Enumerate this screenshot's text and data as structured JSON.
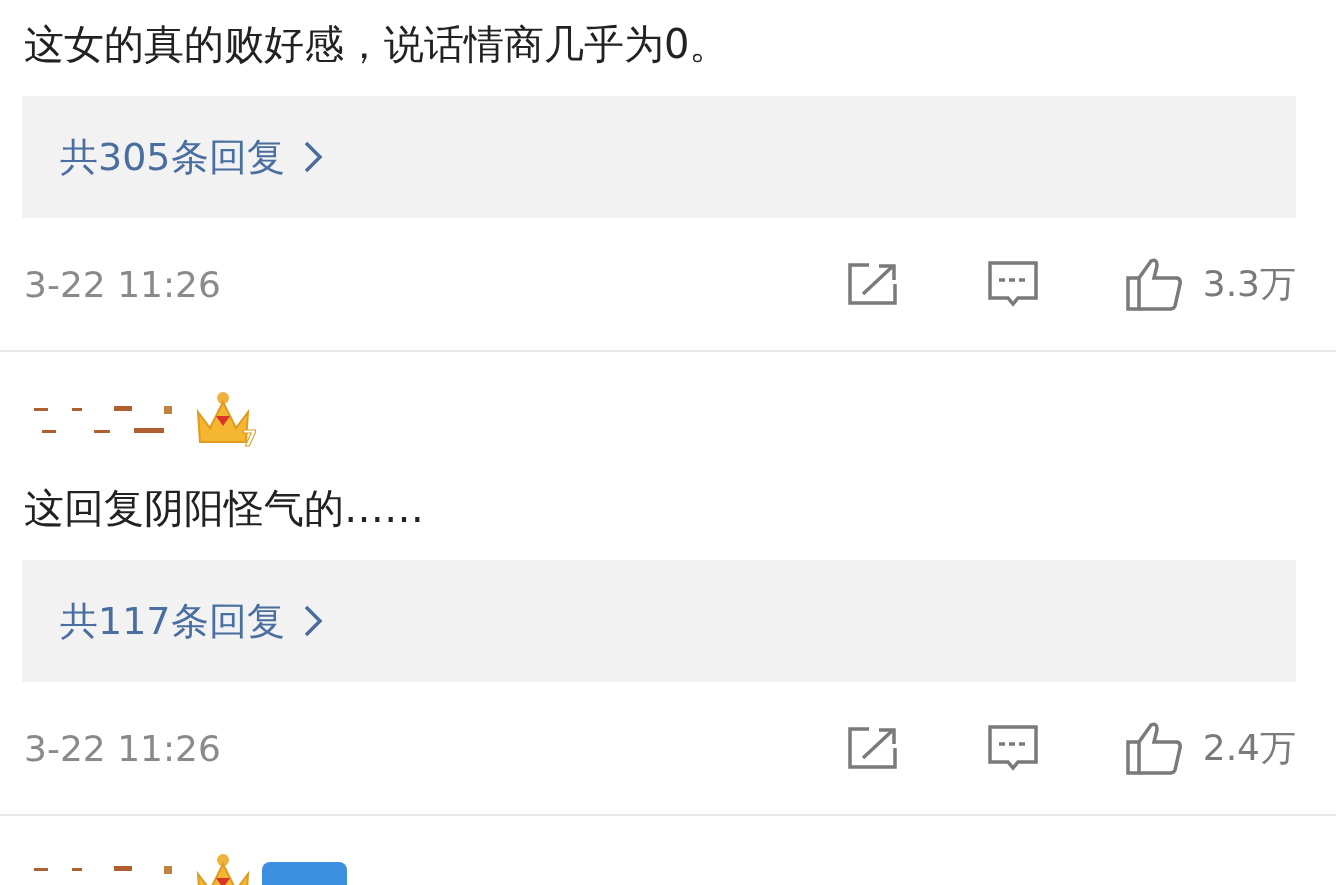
{
  "comments": [
    {
      "kind": "continued",
      "text": "这女的真的败好感，说话情商几乎为0。",
      "replies": "共305条回复",
      "time": "3-22 11:26",
      "likes": "3.3万"
    },
    {
      "kind": "full",
      "vip_level": "7",
      "text": "这回复阴阳怪气的……",
      "replies": "共117条回复",
      "time": "3-22 11:26",
      "likes": "2.4万"
    },
    {
      "kind": "cut"
    }
  ]
}
